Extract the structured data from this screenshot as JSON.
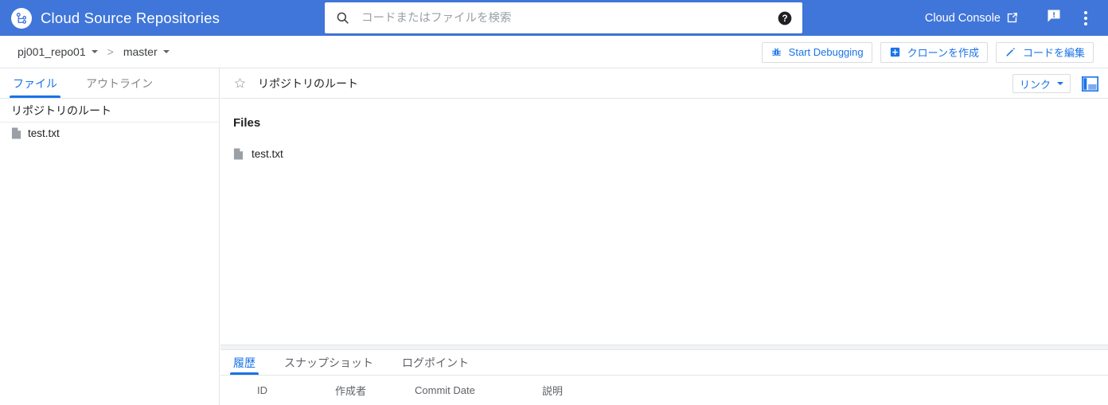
{
  "appbar": {
    "logo_icon": "source-repo-logo-icon",
    "title": "Cloud Source Repositories",
    "search": {
      "icon": "search-icon",
      "value": "",
      "placeholder": "コードまたはファイルを検索",
      "help_icon": "help-circle-icon"
    },
    "console_link": "Cloud Console",
    "external_icon": "external-link-icon",
    "feedback_icon": "feedback-icon",
    "overflow_icon": "more-vert-icon",
    "bg_color": "#4076d9"
  },
  "subbar": {
    "repo": "pj001_repo01",
    "separator": ">",
    "branch": "master",
    "actions": [
      {
        "label": "Start Debugging",
        "icon": "bug-icon"
      },
      {
        "label": "クローンを作成",
        "icon": "add-box-icon"
      },
      {
        "label": "コードを編集",
        "icon": "pencil-icon"
      }
    ],
    "accent_color": "#1a73e8"
  },
  "sidebar": {
    "tabs": [
      {
        "label": "ファイル",
        "active": true
      },
      {
        "label": "アウトライン",
        "active": false
      }
    ],
    "root_label": "リポジトリのルート",
    "files": [
      {
        "name": "test.txt",
        "icon": "file-icon"
      }
    ]
  },
  "main": {
    "star_icon": "star-outline-icon",
    "path_label": "リポジトリのルート",
    "link_button": "リンク",
    "panel_icon": "split-panel-icon",
    "files_heading": "Files",
    "files": [
      {
        "name": "test.txt",
        "icon": "file-icon"
      }
    ]
  },
  "bottom": {
    "tabs": [
      {
        "label": "履歴",
        "active": true
      },
      {
        "label": "スナップショット",
        "active": false
      },
      {
        "label": "ログポイント",
        "active": false
      }
    ],
    "table": {
      "columns": [
        "ID",
        "作成者",
        "Commit Date",
        "説明"
      ],
      "rows": []
    }
  }
}
